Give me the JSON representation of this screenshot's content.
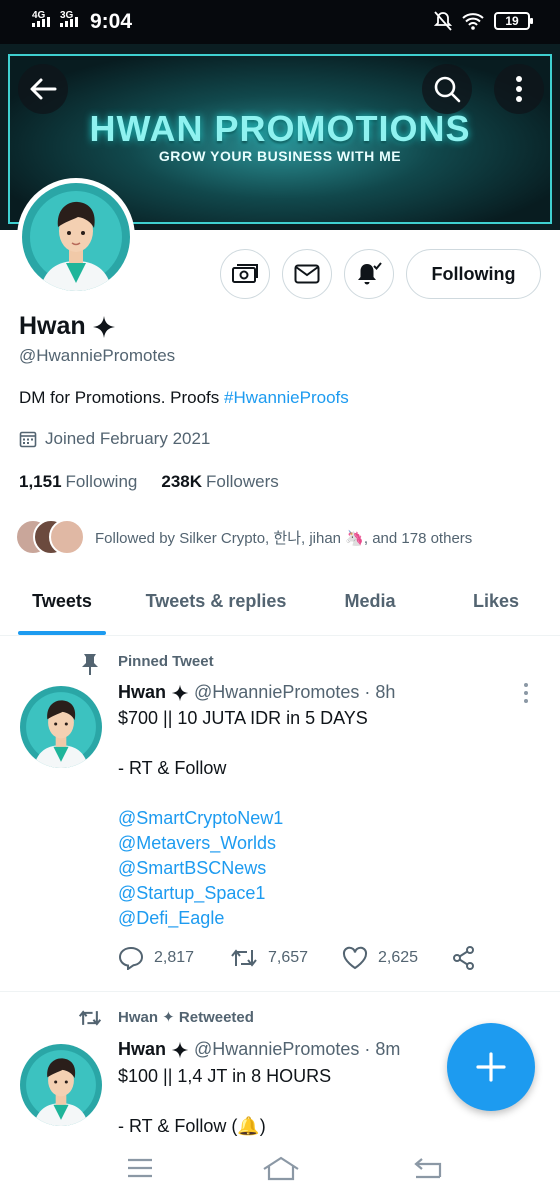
{
  "status_bar": {
    "net1": "4G",
    "net2": "3G",
    "time": "9:04",
    "battery": "19"
  },
  "banner": {
    "title": "HWAN PROMOTIONS",
    "subtitle": "GROW YOUR BUSINESS WITH ME",
    "accent_color": "#3fd0d0"
  },
  "profile": {
    "name": "Hwan",
    "handle": "@HwanniePromotes",
    "bio_text": "DM for Promotions. Proofs ",
    "bio_link": "#HwannieProofs",
    "joined": "Joined February 2021",
    "following_count": "1,151",
    "following_label": "Following",
    "followers_count": "238K",
    "followers_label": "Followers",
    "followed_by": "Followed by Silker Crypto, 한나, jihan 🦄, and 178 others",
    "follow_button": "Following"
  },
  "tabs": [
    {
      "label": "Tweets",
      "active": true
    },
    {
      "label": "Tweets & replies",
      "active": false
    },
    {
      "label": "Media",
      "active": false
    },
    {
      "label": "Likes",
      "active": false
    }
  ],
  "tweets": [
    {
      "context": "Pinned Tweet",
      "context_icon": "pin-icon",
      "name": "Hwan",
      "handle": "@HwanniePromotes",
      "time": "· 8h",
      "lines": [
        "$700 || 10 JUTA IDR in 5 DAYS",
        "",
        "- RT & Follow",
        "",
        "@SmartCryptoNew1",
        "@Metavers_Worlds",
        "@SmartBSCNews",
        "@Startup_Space1",
        "@Defi_Eagle"
      ],
      "replies": "2,817",
      "retweets": "7,657",
      "likes": "2,625"
    },
    {
      "context": "Hwan ✦ Retweeted",
      "context_icon": "retweet-icon",
      "name": "Hwan",
      "handle": "@HwanniePromotes",
      "time": "· 8m",
      "lines": [
        "$100 || 1,4 JT in 8 HOURS",
        "",
        "- RT & Follow (🔔)"
      ]
    }
  ],
  "colors": {
    "link": "#1d9bf0",
    "muted": "#536471",
    "text": "#0f1419"
  }
}
